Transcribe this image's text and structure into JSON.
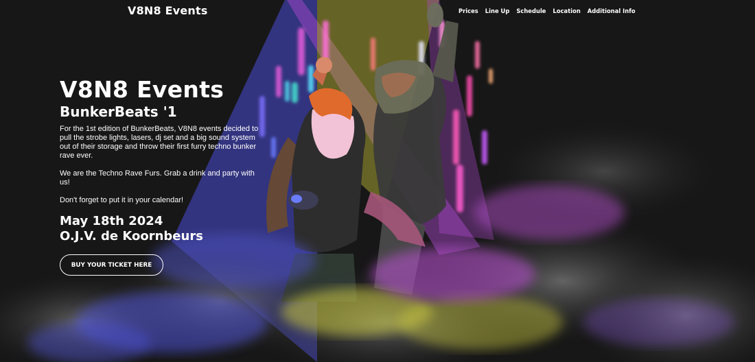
{
  "nav": {
    "brand": "V8N8 Events",
    "links": [
      "Prices",
      "Line Up",
      "Schedule",
      "Location",
      "Additional Info"
    ]
  },
  "hero": {
    "title": "V8N8 Events",
    "subtitle": "BunkerBeats '1",
    "paragraphs": [
      "For the 1st edition of BunkerBeats, V8N8 events decided to pull the strobe lights, lasers, dj set and a big sound system out of their storage and throw their first furry techno bunker rave ever.",
      "We are the Techno Rave Furs. Grab a drink and party with us!",
      "Don't forget to put it in your calendar!"
    ],
    "date": "May 18th 2024",
    "venue": "O.J.V. de Koornbeurs",
    "cta_label": "BUY YOUR TICKET HERE"
  },
  "colors": {
    "background": "#171717",
    "beam_blue": "#4a4dd6",
    "beam_purple": "#b14bd4",
    "beam_yellow": "#c7c23a",
    "smoke_purple": "#b24fc9",
    "smoke_yellow": "#d2d24a"
  }
}
